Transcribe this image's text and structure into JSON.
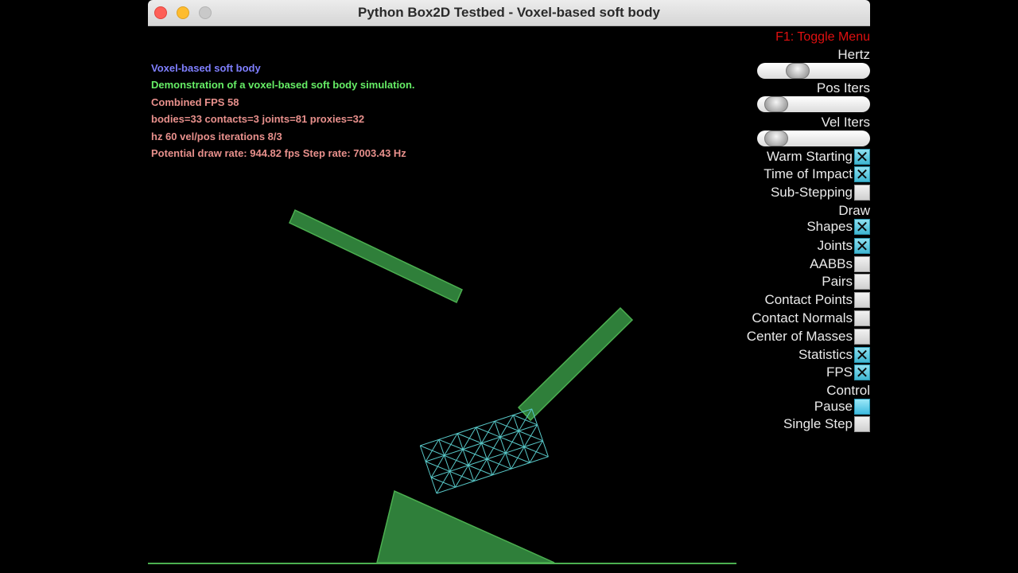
{
  "window": {
    "title": "Python Box2D Testbed - Voxel-based soft body"
  },
  "info": {
    "test_name": "Voxel-based soft body",
    "description": "Demonstration of a voxel-based soft body simulation.",
    "fps": "Combined FPS 58",
    "stats": "bodies=33 contacts=3 joints=81 proxies=32",
    "iterations": "hz 60 vel/pos iterations 8/3",
    "rates": "Potential draw rate: 944.82 fps Step rate: 7003.43 Hz"
  },
  "colors": {
    "test_name": "#7f7fff",
    "description": "#66ee66",
    "stats": "#e8908c",
    "toggle_menu": "#e01010",
    "body_fill": "#2f7f3a",
    "body_edge": "#4caf50",
    "mesh_edge": "#58c8c8"
  },
  "menu": {
    "toggle_label": "F1: Toggle Menu",
    "sliders": [
      {
        "label": "Hertz",
        "value": 0.32
      },
      {
        "label": "Pos Iters",
        "value": 0.08
      },
      {
        "label": "Vel Iters",
        "value": 0.08
      }
    ],
    "options": [
      {
        "label": "Warm Starting",
        "checked": true
      },
      {
        "label": "Time of Impact",
        "checked": true
      },
      {
        "label": "Sub-Stepping",
        "checked": false
      }
    ],
    "draw_header": "Draw",
    "draw_options": [
      {
        "label": "Shapes",
        "checked": true
      },
      {
        "label": "Joints",
        "checked": true
      },
      {
        "label": "AABBs",
        "checked": false
      },
      {
        "label": "Pairs",
        "checked": false
      },
      {
        "label": "Contact Points",
        "checked": false
      },
      {
        "label": "Contact Normals",
        "checked": false
      },
      {
        "label": "Center of Masses",
        "checked": false
      },
      {
        "label": "Statistics",
        "checked": true
      },
      {
        "label": "FPS",
        "checked": true
      }
    ],
    "control_header": "Control",
    "control_options": [
      {
        "label": "Pause",
        "state": "pressed"
      },
      {
        "label": "Single Step",
        "state": "off"
      }
    ]
  }
}
